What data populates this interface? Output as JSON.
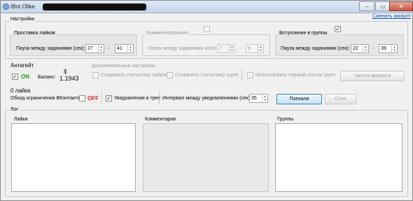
{
  "window": {
    "title": "tBot Olike",
    "buttons": {
      "minimize": "–",
      "maximize": "▭",
      "close": "✕"
    }
  },
  "header": {
    "change_account": "Сменить аккаунт"
  },
  "settings": {
    "group_label": "Настройки",
    "likes": {
      "label": "Проставка лайков",
      "pause_label": "Пауза между заданиями (сек):",
      "from": "27",
      "to": "41",
      "dash": "-"
    },
    "comments": {
      "label": "Комментирование",
      "pause_label": "Пауза между заданиями (сек):",
      "from": "7",
      "to": "9",
      "dash": "-",
      "enabled": false
    },
    "groups": {
      "label": "Вступление в группы",
      "pause_label": "Пауза между заданиями (сек):",
      "from": "22",
      "to": "39",
      "dash": "-",
      "enabled": true,
      "check": "✓"
    }
  },
  "antiban": {
    "label": "Антигейт",
    "on_label": "ON",
    "check": "✓",
    "balance_label": "Баланс:",
    "balance_currency": "$",
    "balance_value": "1.1943"
  },
  "extra": {
    "label": "Дополнительные настройки",
    "save_likes": "Сохранять статистику лайков",
    "save_groups": "Сохранять статистику групп",
    "blacklist": "Использовать черный список групп",
    "clean_account": "Чистка аккаунта"
  },
  "limits": {
    "likes_count": "0 лайка",
    "bypass_label": "Обход ограничения ВКонтакте",
    "off_label": "OFF",
    "tray_label": "Уведомления в трее",
    "tray_check": "✓",
    "interval_label": "Интервал между уведомлениями (сек):",
    "interval_value": "35",
    "start_button": "Поехали",
    "stop_button": "Стоп"
  },
  "log": {
    "label": "Лог",
    "likes": "Лайки",
    "comments": "Комментарии",
    "groups": "Группы"
  }
}
